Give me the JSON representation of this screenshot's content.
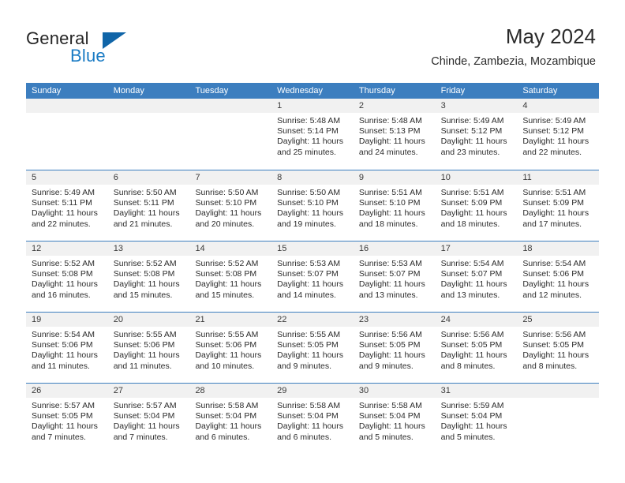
{
  "brand": {
    "word_one": "General",
    "word_two": "Blue",
    "accent_color": "#1065a8",
    "blue_text_color": "#1a7bc4"
  },
  "header": {
    "month_title": "May 2024",
    "location": "Chinde, Zambezia, Mozambique"
  },
  "calendar": {
    "header_color": "#3c7ebf",
    "day_strip_color": "#f1f1f1",
    "weekdays": [
      "Sunday",
      "Monday",
      "Tuesday",
      "Wednesday",
      "Thursday",
      "Friday",
      "Saturday"
    ],
    "weeks": [
      [
        {
          "day": "",
          "sunrise": "",
          "sunset": "",
          "daylight": "",
          "empty": true
        },
        {
          "day": "",
          "sunrise": "",
          "sunset": "",
          "daylight": "",
          "empty": true
        },
        {
          "day": "",
          "sunrise": "",
          "sunset": "",
          "daylight": "",
          "empty": true
        },
        {
          "day": "1",
          "sunrise": "Sunrise: 5:48 AM",
          "sunset": "Sunset: 5:14 PM",
          "daylight": "Daylight: 11 hours and 25 minutes.",
          "empty": false
        },
        {
          "day": "2",
          "sunrise": "Sunrise: 5:48 AM",
          "sunset": "Sunset: 5:13 PM",
          "daylight": "Daylight: 11 hours and 24 minutes.",
          "empty": false
        },
        {
          "day": "3",
          "sunrise": "Sunrise: 5:49 AM",
          "sunset": "Sunset: 5:12 PM",
          "daylight": "Daylight: 11 hours and 23 minutes.",
          "empty": false
        },
        {
          "day": "4",
          "sunrise": "Sunrise: 5:49 AM",
          "sunset": "Sunset: 5:12 PM",
          "daylight": "Daylight: 11 hours and 22 minutes.",
          "empty": false
        }
      ],
      [
        {
          "day": "5",
          "sunrise": "Sunrise: 5:49 AM",
          "sunset": "Sunset: 5:11 PM",
          "daylight": "Daylight: 11 hours and 22 minutes.",
          "empty": false
        },
        {
          "day": "6",
          "sunrise": "Sunrise: 5:50 AM",
          "sunset": "Sunset: 5:11 PM",
          "daylight": "Daylight: 11 hours and 21 minutes.",
          "empty": false
        },
        {
          "day": "7",
          "sunrise": "Sunrise: 5:50 AM",
          "sunset": "Sunset: 5:10 PM",
          "daylight": "Daylight: 11 hours and 20 minutes.",
          "empty": false
        },
        {
          "day": "8",
          "sunrise": "Sunrise: 5:50 AM",
          "sunset": "Sunset: 5:10 PM",
          "daylight": "Daylight: 11 hours and 19 minutes.",
          "empty": false
        },
        {
          "day": "9",
          "sunrise": "Sunrise: 5:51 AM",
          "sunset": "Sunset: 5:10 PM",
          "daylight": "Daylight: 11 hours and 18 minutes.",
          "empty": false
        },
        {
          "day": "10",
          "sunrise": "Sunrise: 5:51 AM",
          "sunset": "Sunset: 5:09 PM",
          "daylight": "Daylight: 11 hours and 18 minutes.",
          "empty": false
        },
        {
          "day": "11",
          "sunrise": "Sunrise: 5:51 AM",
          "sunset": "Sunset: 5:09 PM",
          "daylight": "Daylight: 11 hours and 17 minutes.",
          "empty": false
        }
      ],
      [
        {
          "day": "12",
          "sunrise": "Sunrise: 5:52 AM",
          "sunset": "Sunset: 5:08 PM",
          "daylight": "Daylight: 11 hours and 16 minutes.",
          "empty": false
        },
        {
          "day": "13",
          "sunrise": "Sunrise: 5:52 AM",
          "sunset": "Sunset: 5:08 PM",
          "daylight": "Daylight: 11 hours and 15 minutes.",
          "empty": false
        },
        {
          "day": "14",
          "sunrise": "Sunrise: 5:52 AM",
          "sunset": "Sunset: 5:08 PM",
          "daylight": "Daylight: 11 hours and 15 minutes.",
          "empty": false
        },
        {
          "day": "15",
          "sunrise": "Sunrise: 5:53 AM",
          "sunset": "Sunset: 5:07 PM",
          "daylight": "Daylight: 11 hours and 14 minutes.",
          "empty": false
        },
        {
          "day": "16",
          "sunrise": "Sunrise: 5:53 AM",
          "sunset": "Sunset: 5:07 PM",
          "daylight": "Daylight: 11 hours and 13 minutes.",
          "empty": false
        },
        {
          "day": "17",
          "sunrise": "Sunrise: 5:54 AM",
          "sunset": "Sunset: 5:07 PM",
          "daylight": "Daylight: 11 hours and 13 minutes.",
          "empty": false
        },
        {
          "day": "18",
          "sunrise": "Sunrise: 5:54 AM",
          "sunset": "Sunset: 5:06 PM",
          "daylight": "Daylight: 11 hours and 12 minutes.",
          "empty": false
        }
      ],
      [
        {
          "day": "19",
          "sunrise": "Sunrise: 5:54 AM",
          "sunset": "Sunset: 5:06 PM",
          "daylight": "Daylight: 11 hours and 11 minutes.",
          "empty": false
        },
        {
          "day": "20",
          "sunrise": "Sunrise: 5:55 AM",
          "sunset": "Sunset: 5:06 PM",
          "daylight": "Daylight: 11 hours and 11 minutes.",
          "empty": false
        },
        {
          "day": "21",
          "sunrise": "Sunrise: 5:55 AM",
          "sunset": "Sunset: 5:06 PM",
          "daylight": "Daylight: 11 hours and 10 minutes.",
          "empty": false
        },
        {
          "day": "22",
          "sunrise": "Sunrise: 5:55 AM",
          "sunset": "Sunset: 5:05 PM",
          "daylight": "Daylight: 11 hours and 9 minutes.",
          "empty": false
        },
        {
          "day": "23",
          "sunrise": "Sunrise: 5:56 AM",
          "sunset": "Sunset: 5:05 PM",
          "daylight": "Daylight: 11 hours and 9 minutes.",
          "empty": false
        },
        {
          "day": "24",
          "sunrise": "Sunrise: 5:56 AM",
          "sunset": "Sunset: 5:05 PM",
          "daylight": "Daylight: 11 hours and 8 minutes.",
          "empty": false
        },
        {
          "day": "25",
          "sunrise": "Sunrise: 5:56 AM",
          "sunset": "Sunset: 5:05 PM",
          "daylight": "Daylight: 11 hours and 8 minutes.",
          "empty": false
        }
      ],
      [
        {
          "day": "26",
          "sunrise": "Sunrise: 5:57 AM",
          "sunset": "Sunset: 5:05 PM",
          "daylight": "Daylight: 11 hours and 7 minutes.",
          "empty": false
        },
        {
          "day": "27",
          "sunrise": "Sunrise: 5:57 AM",
          "sunset": "Sunset: 5:04 PM",
          "daylight": "Daylight: 11 hours and 7 minutes.",
          "empty": false
        },
        {
          "day": "28",
          "sunrise": "Sunrise: 5:58 AM",
          "sunset": "Sunset: 5:04 PM",
          "daylight": "Daylight: 11 hours and 6 minutes.",
          "empty": false
        },
        {
          "day": "29",
          "sunrise": "Sunrise: 5:58 AM",
          "sunset": "Sunset: 5:04 PM",
          "daylight": "Daylight: 11 hours and 6 minutes.",
          "empty": false
        },
        {
          "day": "30",
          "sunrise": "Sunrise: 5:58 AM",
          "sunset": "Sunset: 5:04 PM",
          "daylight": "Daylight: 11 hours and 5 minutes.",
          "empty": false
        },
        {
          "day": "31",
          "sunrise": "Sunrise: 5:59 AM",
          "sunset": "Sunset: 5:04 PM",
          "daylight": "Daylight: 11 hours and 5 minutes.",
          "empty": false
        },
        {
          "day": "",
          "sunrise": "",
          "sunset": "",
          "daylight": "",
          "empty": true
        }
      ]
    ]
  }
}
